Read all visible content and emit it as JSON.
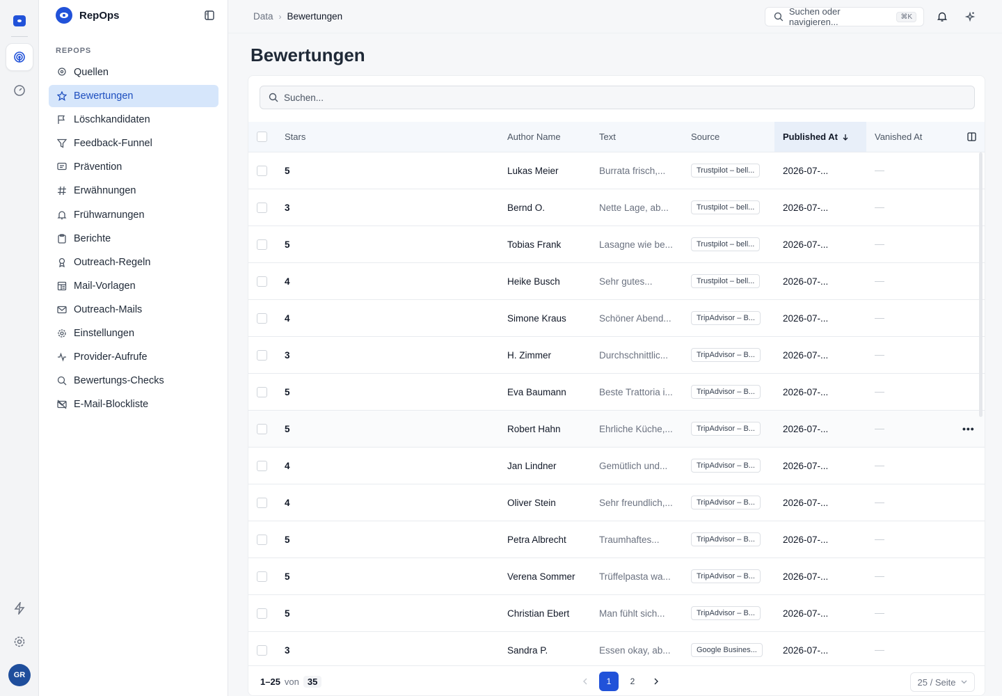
{
  "app": {
    "name": "RepOps",
    "user_initials": "GR"
  },
  "rail": {
    "items": [
      "radar-icon",
      "gauge-icon"
    ],
    "bottom": [
      "bolt-icon",
      "gear-icon"
    ]
  },
  "sidebar": {
    "section": "REPOPS",
    "items": [
      {
        "label": "Quellen",
        "icon": "location-pin-icon"
      },
      {
        "label": "Bewertungen",
        "icon": "star-icon",
        "active": true
      },
      {
        "label": "Löschkandidaten",
        "icon": "flag-icon"
      },
      {
        "label": "Feedback-Funnel",
        "icon": "funnel-icon"
      },
      {
        "label": "Prävention",
        "icon": "message-icon"
      },
      {
        "label": "Erwähnungen",
        "icon": "hash-icon"
      },
      {
        "label": "Frühwarnungen",
        "icon": "bell-icon"
      },
      {
        "label": "Berichte",
        "icon": "clipboard-icon"
      },
      {
        "label": "Outreach-Regeln",
        "icon": "ribbon-icon"
      },
      {
        "label": "Mail-Vorlagen",
        "icon": "template-icon"
      },
      {
        "label": "Outreach-Mails",
        "icon": "mail-icon"
      },
      {
        "label": "Einstellungen",
        "icon": "gear-icon"
      },
      {
        "label": "Provider-Aufrufe",
        "icon": "activity-icon"
      },
      {
        "label": "Bewertungs-Checks",
        "icon": "search-icon"
      },
      {
        "label": "E-Mail-Blockliste",
        "icon": "mail-off-icon"
      }
    ]
  },
  "topbar": {
    "breadcrumb": [
      "Data",
      "Bewertungen"
    ],
    "search_placeholder": "Suchen oder navigieren...",
    "shortcut": "⌘K"
  },
  "page": {
    "title": "Bewertungen",
    "search_placeholder": "Suchen..."
  },
  "table": {
    "columns": [
      "Stars",
      "Author Name",
      "Text",
      "Source",
      "Published At",
      "Vanished At"
    ],
    "sort": {
      "column": "Published At",
      "direction": "desc"
    },
    "rows": [
      {
        "stars": "5",
        "author": "Lukas Meier",
        "text": "Burrata frisch,...",
        "source": "Trustpilot – bell...",
        "published": "2026-07-..."
      },
      {
        "stars": "3",
        "author": "Bernd O.",
        "text": "Nette Lage, ab...",
        "source": "Trustpilot – bell...",
        "published": "2026-07-..."
      },
      {
        "stars": "5",
        "author": "Tobias Frank",
        "text": "Lasagne wie be...",
        "source": "Trustpilot – bell...",
        "published": "2026-07-..."
      },
      {
        "stars": "4",
        "author": "Heike Busch",
        "text": "Sehr gutes...",
        "source": "Trustpilot – bell...",
        "published": "2026-07-..."
      },
      {
        "stars": "4",
        "author": "Simone Kraus",
        "text": "Schöner Abend...",
        "source": "TripAdvisor – B...",
        "published": "2026-07-..."
      },
      {
        "stars": "3",
        "author": "H. Zimmer",
        "text": "Durchschnittlic...",
        "source": "TripAdvisor – B...",
        "published": "2026-07-..."
      },
      {
        "stars": "5",
        "author": "Eva Baumann",
        "text": "Beste Trattoria i...",
        "source": "TripAdvisor – B...",
        "published": "2026-07-..."
      },
      {
        "stars": "5",
        "author": "Robert Hahn",
        "text": "Ehrliche Küche,...",
        "source": "TripAdvisor – B...",
        "published": "2026-07-...",
        "hover": true
      },
      {
        "stars": "4",
        "author": "Jan Lindner",
        "text": "Gemütlich und...",
        "source": "TripAdvisor – B...",
        "published": "2026-07-..."
      },
      {
        "stars": "4",
        "author": "Oliver Stein",
        "text": "Sehr freundlich,...",
        "source": "TripAdvisor – B...",
        "published": "2026-07-..."
      },
      {
        "stars": "5",
        "author": "Petra Albrecht",
        "text": "Traumhaftes...",
        "source": "TripAdvisor – B...",
        "published": "2026-07-..."
      },
      {
        "stars": "5",
        "author": "Verena Sommer",
        "text": "Trüffelpasta wa...",
        "source": "TripAdvisor – B...",
        "published": "2026-07-..."
      },
      {
        "stars": "5",
        "author": "Christian Ebert",
        "text": "Man fühlt sich...",
        "source": "TripAdvisor – B...",
        "published": "2026-07-..."
      },
      {
        "stars": "3",
        "author": "Sandra P.",
        "text": "Essen okay, ab...",
        "source": "Google Busines...",
        "published": "2026-07-..."
      }
    ]
  },
  "pagination": {
    "range": "1–25",
    "of_label": "von",
    "total": "35",
    "pages": [
      "1",
      "2"
    ],
    "current": "1",
    "per_page": "25 / Seite"
  },
  "colors": {
    "accent": "#2152d9",
    "active_nav_bg": "#d6e6fb"
  }
}
